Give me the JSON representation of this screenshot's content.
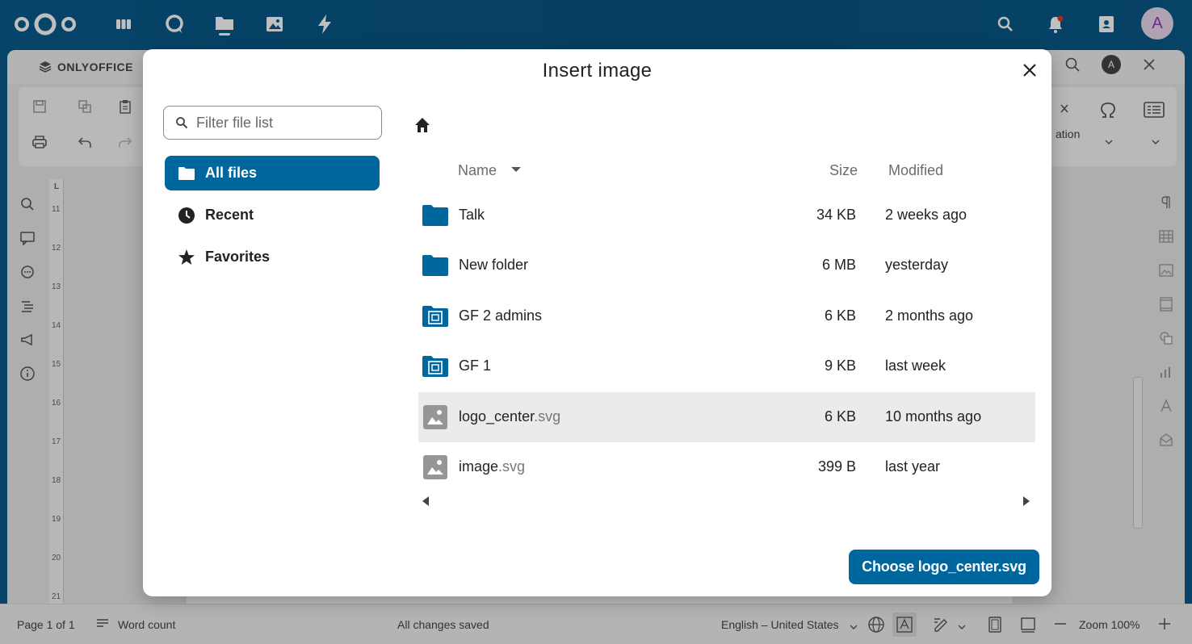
{
  "colors": {
    "brand": "#00679e",
    "folder": "#00679e",
    "selected_row": "#ebebeb",
    "avatar_bg": "#e9d9ef",
    "avatar_fg": "#8e3fa7"
  },
  "nextcloud": {
    "app_icons": [
      "dashboard-icon",
      "talk-icon",
      "files-icon",
      "photos-icon",
      "activity-icon"
    ],
    "right_icons": [
      "search-icon",
      "notifications-icon",
      "contacts-icon"
    ],
    "avatar_letter": "A"
  },
  "editor": {
    "brand": "ONLYOFFICE",
    "user_initial": "A",
    "toolbar_partial_label": "ation",
    "ruler_numbers": [
      "11",
      "12",
      "13",
      "14",
      "15",
      "16",
      "17",
      "18",
      "19",
      "20",
      "21"
    ],
    "ruler_corner": "L",
    "status": {
      "page": "Page 1 of 1",
      "word_count": "Word count",
      "saved": "All changes saved",
      "language": "English – United States",
      "zoom": "Zoom 100%"
    }
  },
  "dialog": {
    "title": "Insert image",
    "filter_placeholder": "Filter file list",
    "nav": [
      {
        "label": "All files",
        "icon": "folder-icon",
        "active": true
      },
      {
        "label": "Recent",
        "icon": "clock-icon",
        "active": false
      },
      {
        "label": "Favorites",
        "icon": "star-icon",
        "active": false
      }
    ],
    "columns": {
      "name": "Name",
      "size": "Size",
      "modified": "Modified"
    },
    "files": [
      {
        "name": "Talk",
        "ext": "",
        "type": "folder",
        "size": "34 KB",
        "modified": "2 weeks ago",
        "selected": false
      },
      {
        "name": "New folder",
        "ext": "",
        "type": "folder",
        "size": "6 MB",
        "modified": "yesterday",
        "selected": false
      },
      {
        "name": "GF 2 admins",
        "ext": "",
        "type": "group-folder",
        "size": "6 KB",
        "modified": "2 months ago",
        "selected": false
      },
      {
        "name": "GF 1",
        "ext": "",
        "type": "group-folder",
        "size": "9 KB",
        "modified": "last week",
        "selected": false
      },
      {
        "name": "logo_center",
        "ext": ".svg",
        "type": "image",
        "size": "6 KB",
        "modified": "10 months ago",
        "selected": true
      },
      {
        "name": "image",
        "ext": ".svg",
        "type": "image",
        "size": "399 B",
        "modified": "last year",
        "selected": false
      }
    ],
    "choose_button": "Choose logo_center.svg"
  }
}
